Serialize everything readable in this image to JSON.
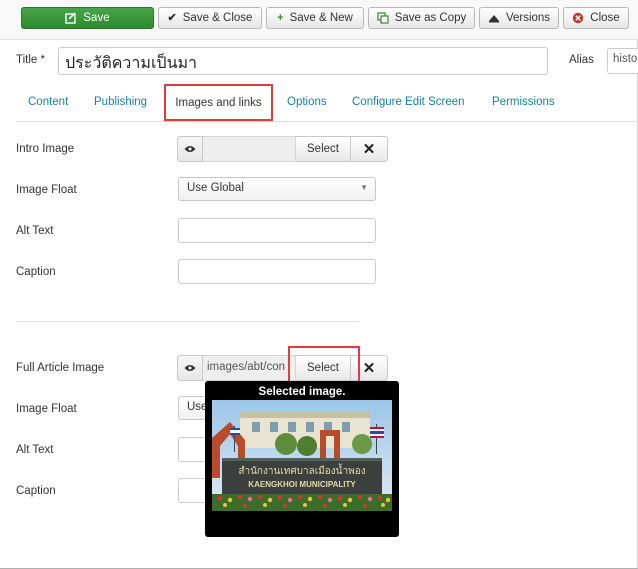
{
  "toolbar": {
    "save": "Save",
    "save_close": "Save & Close",
    "save_new": "Save & New",
    "save_copy": "Save as Copy",
    "versions": "Versions",
    "close": "Close"
  },
  "title": {
    "label": "Title *",
    "value": "ประวัติความเป็นมา"
  },
  "alias": {
    "label": "Alias",
    "value": "histo"
  },
  "tabs": [
    {
      "label": "Content"
    },
    {
      "label": "Publishing"
    },
    {
      "label": "Images and links"
    },
    {
      "label": "Options"
    },
    {
      "label": "Configure Edit Screen"
    },
    {
      "label": "Permissions"
    }
  ],
  "active_tab": "Images and links",
  "intro": {
    "image_label": "Intro Image",
    "image_value": "",
    "select_label": "Select",
    "float_label": "Image Float",
    "float_value": "Use Global",
    "alt_label": "Alt Text",
    "caption_label": "Caption"
  },
  "full": {
    "image_label": "Full Article Image",
    "image_value": "images/abt/con",
    "select_label": "Select",
    "float_label": "Image Float",
    "float_value": "Use Global",
    "alt_label": "Alt Text",
    "caption_label": "Caption"
  },
  "tooltip": {
    "title": "Selected image.",
    "sign_thai": "สำนักงานเทศบาลเมืองน้ำพอง",
    "sign_en": "KAENGKHOI MUNICIPALITY"
  },
  "colors": {
    "accent_link": "#1a7fa8",
    "save_green": "#3a963a",
    "highlight_red": "#e23b3b"
  },
  "icons": {
    "save": "save-icon",
    "check": "check-icon",
    "plus": "plus-icon",
    "copy": "copy-icon",
    "versions": "versions-icon",
    "close": "close-icon",
    "preview": "eye-icon",
    "clear": "x-icon"
  }
}
